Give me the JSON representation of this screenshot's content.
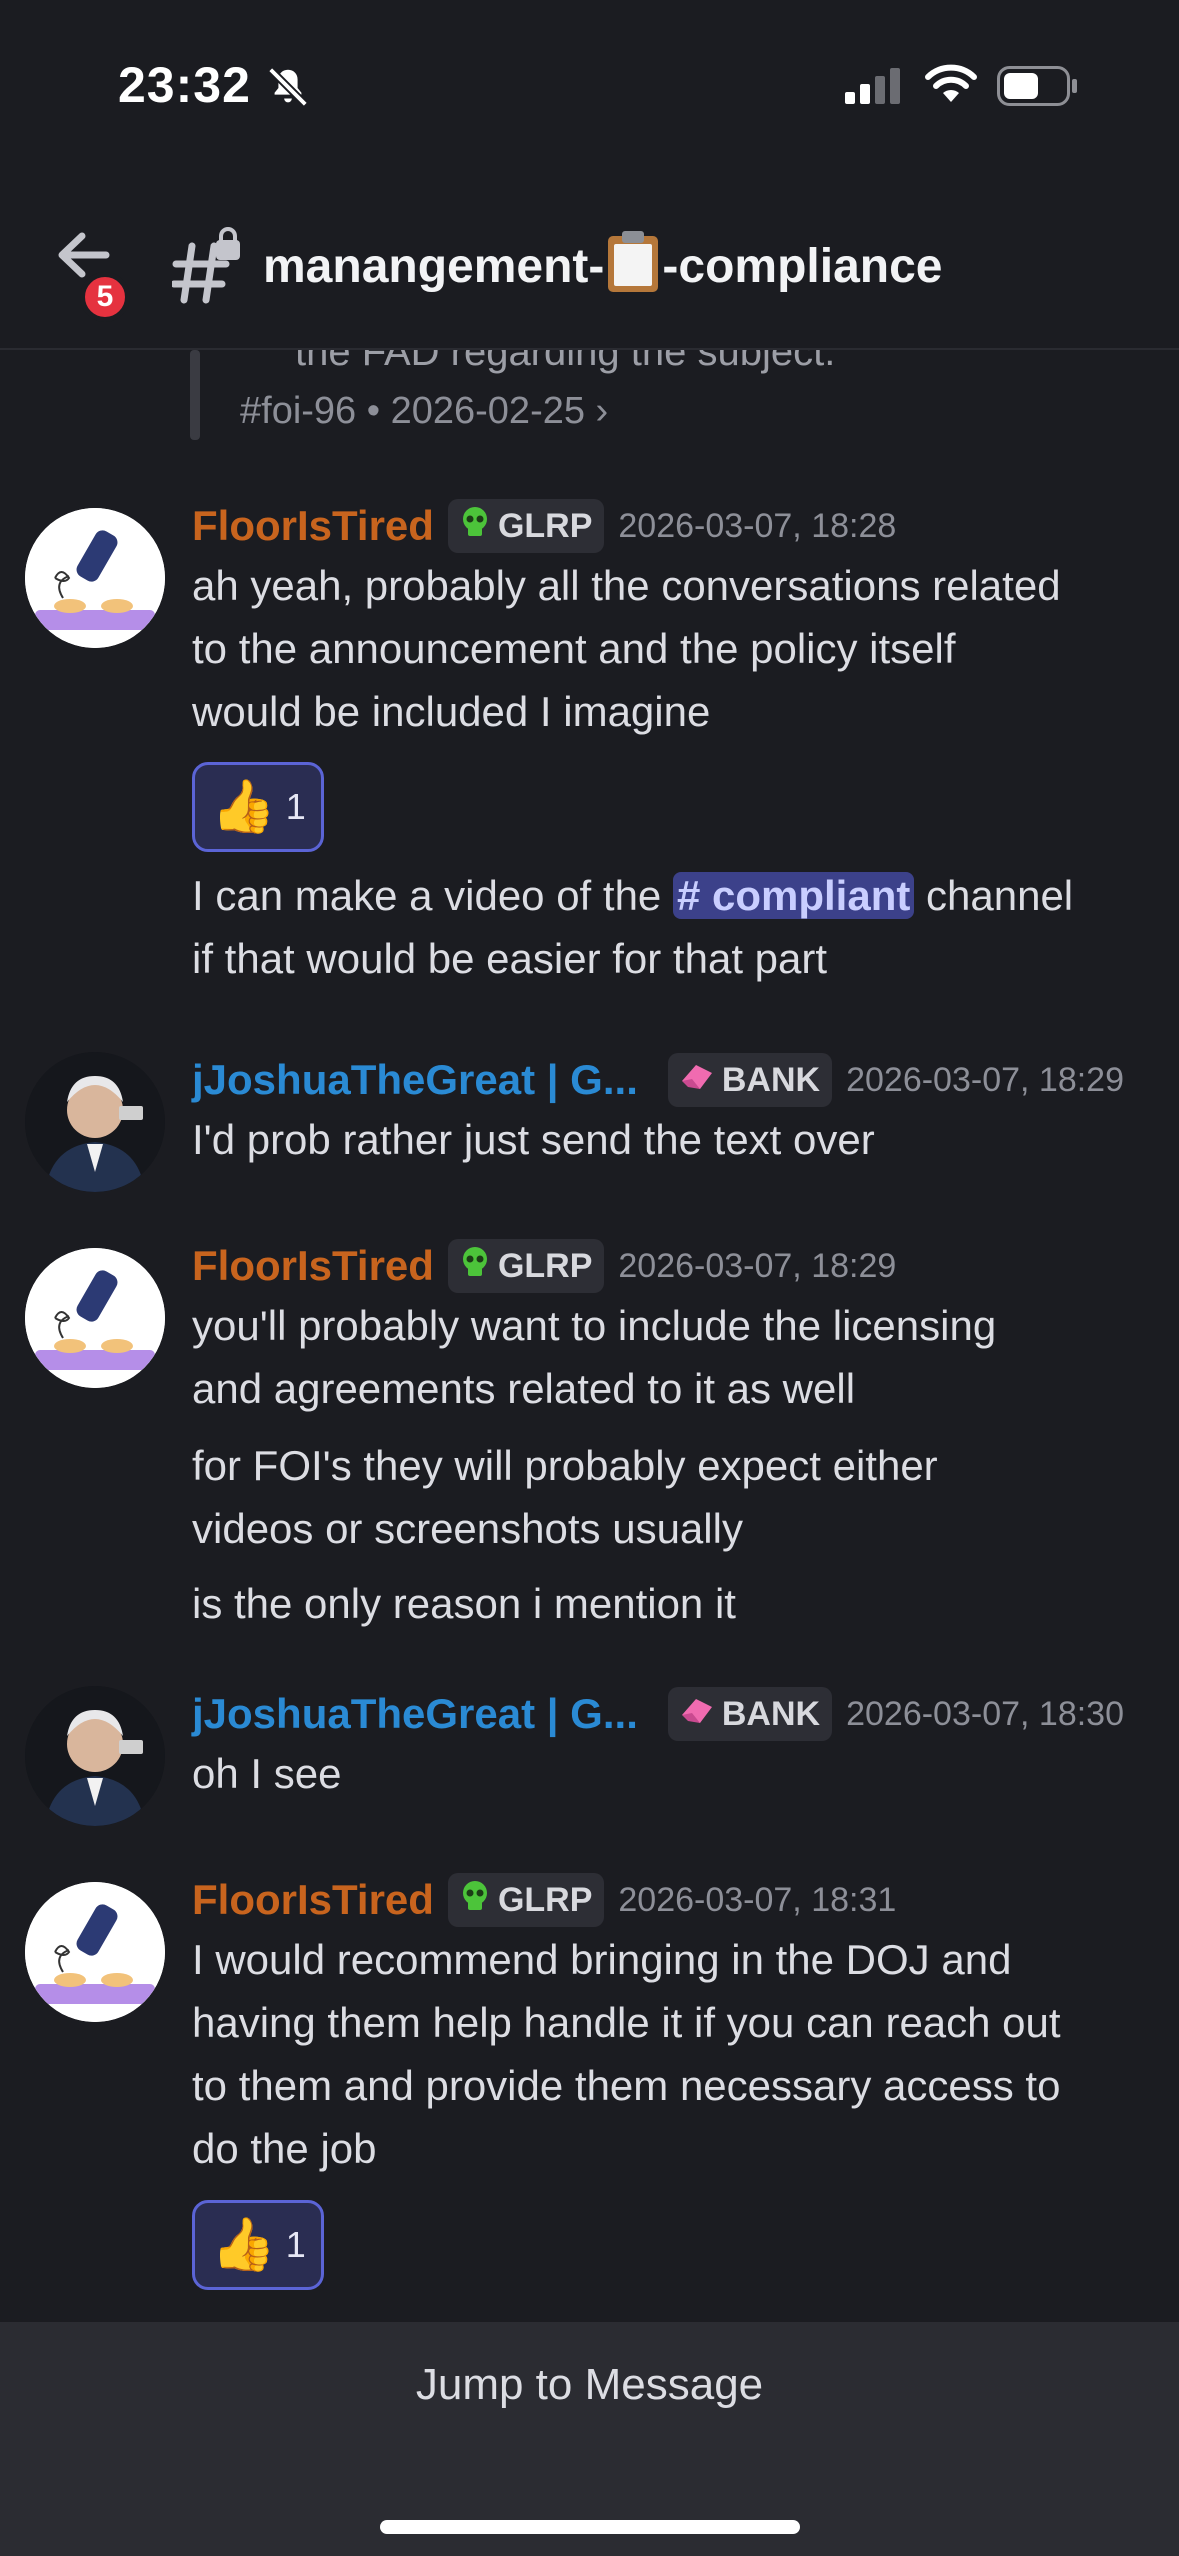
{
  "status": {
    "time": "23:32"
  },
  "header": {
    "badge": "5",
    "channel_prefix": "manangement-",
    "channel_suffix": "-compliance"
  },
  "thread": {
    "cut_text": "the FAD regarding the subject.",
    "meta": "#foi-96 • 2026-02-25  ›"
  },
  "messages": [
    {
      "author": "FloorIsTired",
      "role": "GLRP",
      "time": "2026-03-07, 18:28",
      "lines": [
        "ah yeah, probably all the conversations related",
        "to the announcement and the policy itself",
        "would be included I imagine"
      ],
      "reaction_count": "1",
      "followup_pre": "I can make a video of the ",
      "mention": "# compliant",
      "followup_post": " channel",
      "followup_line2": "if that would be easier for that part"
    },
    {
      "author": "jJoshuaTheGreat | G...",
      "role": "BANK",
      "time": "2026-03-07, 18:29",
      "lines": [
        "I'd prob rather just send the text over"
      ]
    },
    {
      "author": "FloorIsTired",
      "role": "GLRP",
      "time": "2026-03-07, 18:29",
      "lines": [
        "you'll probably want to include the licensing",
        "and agreements related to it as well"
      ],
      "extra": [
        "for FOI's they will probably expect either",
        "videos or screenshots usually"
      ],
      "extra2": "is the only reason i mention it"
    },
    {
      "author": "jJoshuaTheGreat | G...",
      "role": "BANK",
      "time": "2026-03-07, 18:30",
      "lines": [
        "oh I see"
      ]
    },
    {
      "author": "FloorIsTired",
      "role": "GLRP",
      "time": "2026-03-07, 18:31",
      "lines": [
        "I would recommend bringing in the DOJ and",
        "having them help handle it if you can reach out",
        "to them and provide them necessary access to",
        "do the job"
      ],
      "reaction_count": "1"
    }
  ],
  "jump": {
    "label": "Jump to Message"
  },
  "colors": {
    "floor": "#c8641e",
    "josh": "#2a8ad4",
    "mention_bg": "#3c418a",
    "reaction_border": "#5b64d6"
  }
}
